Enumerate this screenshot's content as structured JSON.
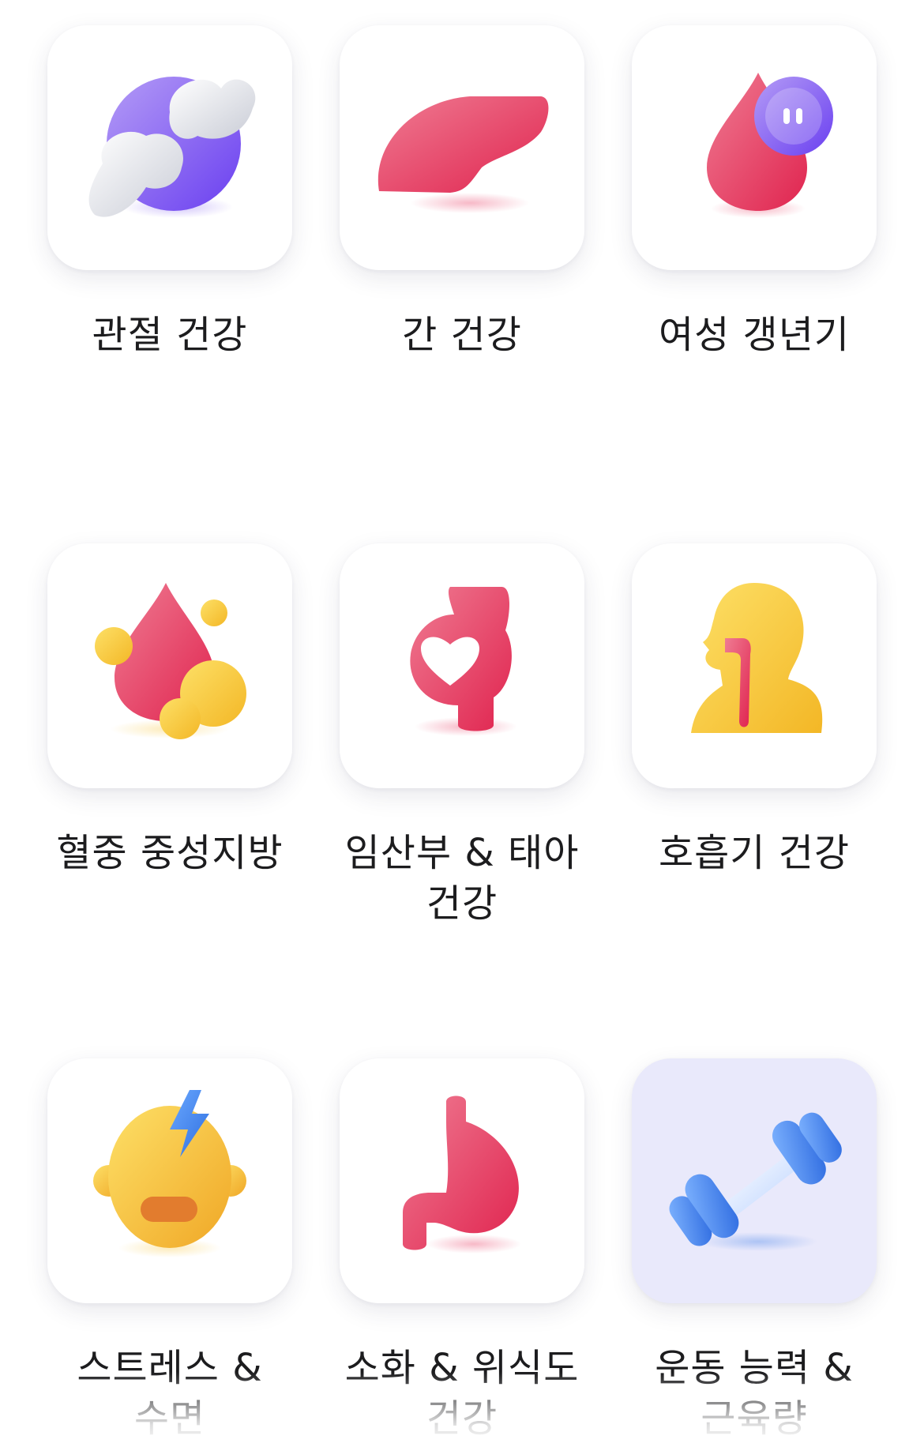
{
  "categories": [
    {
      "label": "관절 건강",
      "icon": "joint-bone-icon"
    },
    {
      "label": "간 건강",
      "icon": "liver-icon"
    },
    {
      "label": "여성 갱년기",
      "icon": "blood-drop-female-icon"
    },
    {
      "label": "혈중 중성지방",
      "icon": "blood-fat-icon"
    },
    {
      "label": "임산부 & 태아\n건강",
      "icon": "pregnant-heart-icon"
    },
    {
      "label": "호흡기 건강",
      "icon": "respiratory-icon"
    },
    {
      "label": "스트레스 &\n수면",
      "icon": "stress-face-icon"
    },
    {
      "label": "소화 & 위식도\n건강",
      "icon": "stomach-icon"
    },
    {
      "label": "운동 능력 &\n근육량",
      "icon": "dumbbell-icon"
    }
  ],
  "selected_category": "운동 능력 &\n근육량",
  "colors": {
    "pink": "#e8365f",
    "purple": "#7b57f0",
    "yellow": "#f8c63a",
    "blue": "#3f7ee8",
    "selected_tile": "#e9e9fb"
  }
}
